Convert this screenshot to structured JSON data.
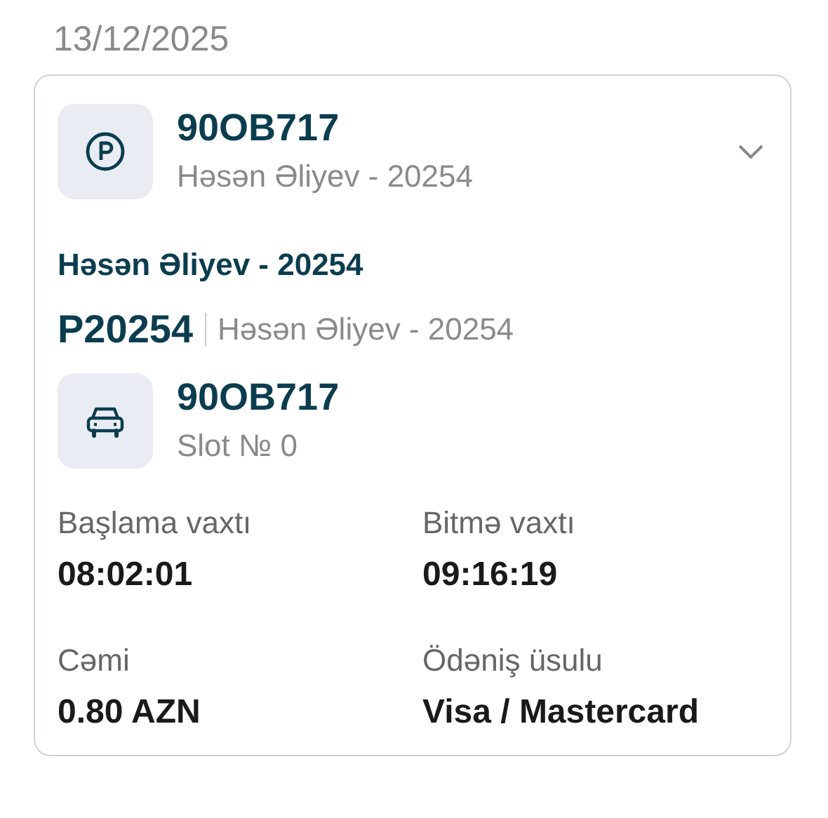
{
  "date": "13/12/2025",
  "card": {
    "expanded": false,
    "header": {
      "plate": "90OB717",
      "owner": "Həsən Əliyev - 20254"
    },
    "customer": "Həsən Əliyev - 20254",
    "parking": {
      "code": "P20254",
      "name": "Həsən Əliyev - 20254"
    },
    "vehicle": {
      "plate": "90OB717",
      "slot": "Slot № 0"
    },
    "details": [
      {
        "label": "Başlama vaxtı",
        "value": "08:02:01"
      },
      {
        "label": "Bitmə vaxtı",
        "value": "09:16:19"
      },
      {
        "label": "Cəmi",
        "value": "0.80 AZN"
      },
      {
        "label": "Ödəniş üsulu",
        "value": "Visa / Mastercard"
      }
    ]
  }
}
